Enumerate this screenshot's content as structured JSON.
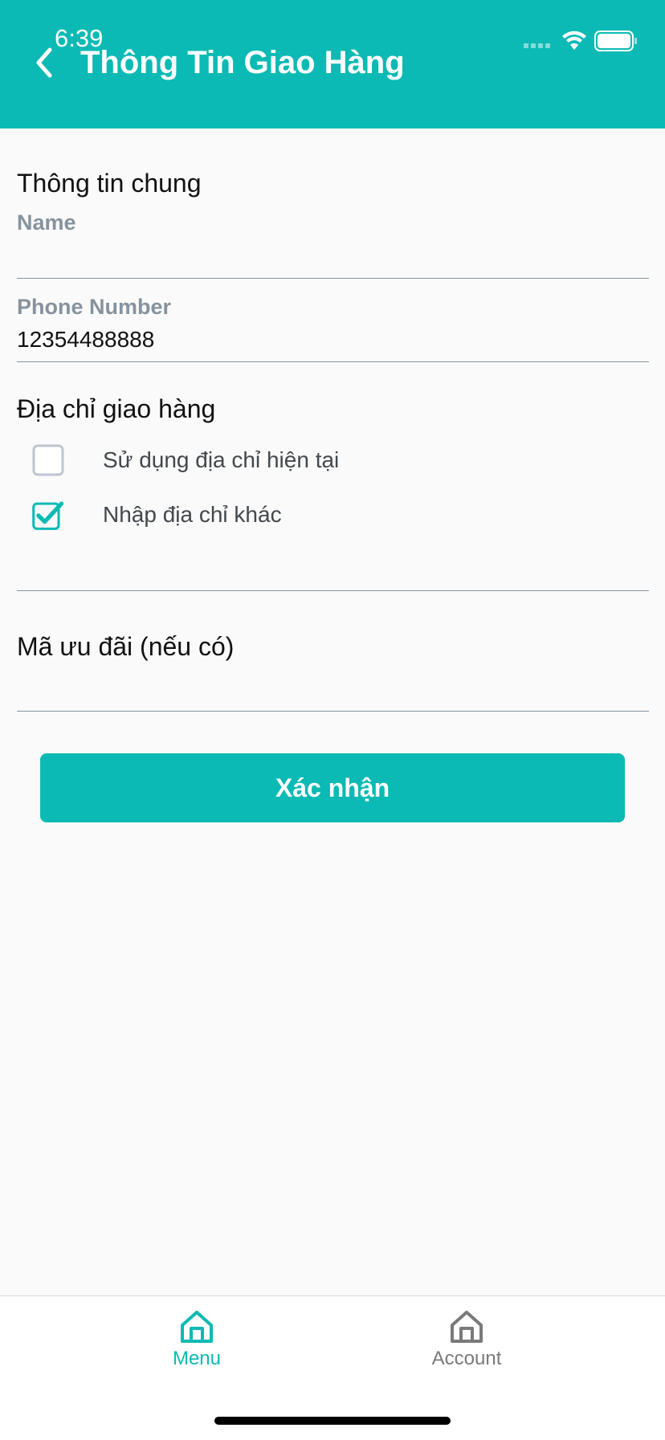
{
  "status_bar": {
    "time": "6:39"
  },
  "header": {
    "title": "Thông Tin Giao Hàng",
    "back_icon": "chevron-left-icon"
  },
  "general_section": {
    "title": "Thông tin chung"
  },
  "name_field": {
    "label": "Name",
    "value": ""
  },
  "phone_field": {
    "label": "Phone Number",
    "value": "12354488888"
  },
  "address_section": {
    "title": "Địa chỉ giao hàng",
    "options": [
      {
        "label": "Sử dụng địa chỉ hiện tại",
        "checked": false
      },
      {
        "label": "Nhập địa chỉ khác",
        "checked": true
      }
    ]
  },
  "promo_section": {
    "title": "Mã ưu đãi (nếu có)"
  },
  "confirm_button": {
    "label": "Xác nhận"
  },
  "tabbar": {
    "tabs": [
      {
        "label": "Menu",
        "icon": "home-icon",
        "active": true
      },
      {
        "label": "Account",
        "icon": "home-icon",
        "active": false
      }
    ]
  },
  "colors": {
    "primary": "#0bbab4",
    "label_gray": "#86939e",
    "inactive_tab": "#7a7a7a"
  }
}
